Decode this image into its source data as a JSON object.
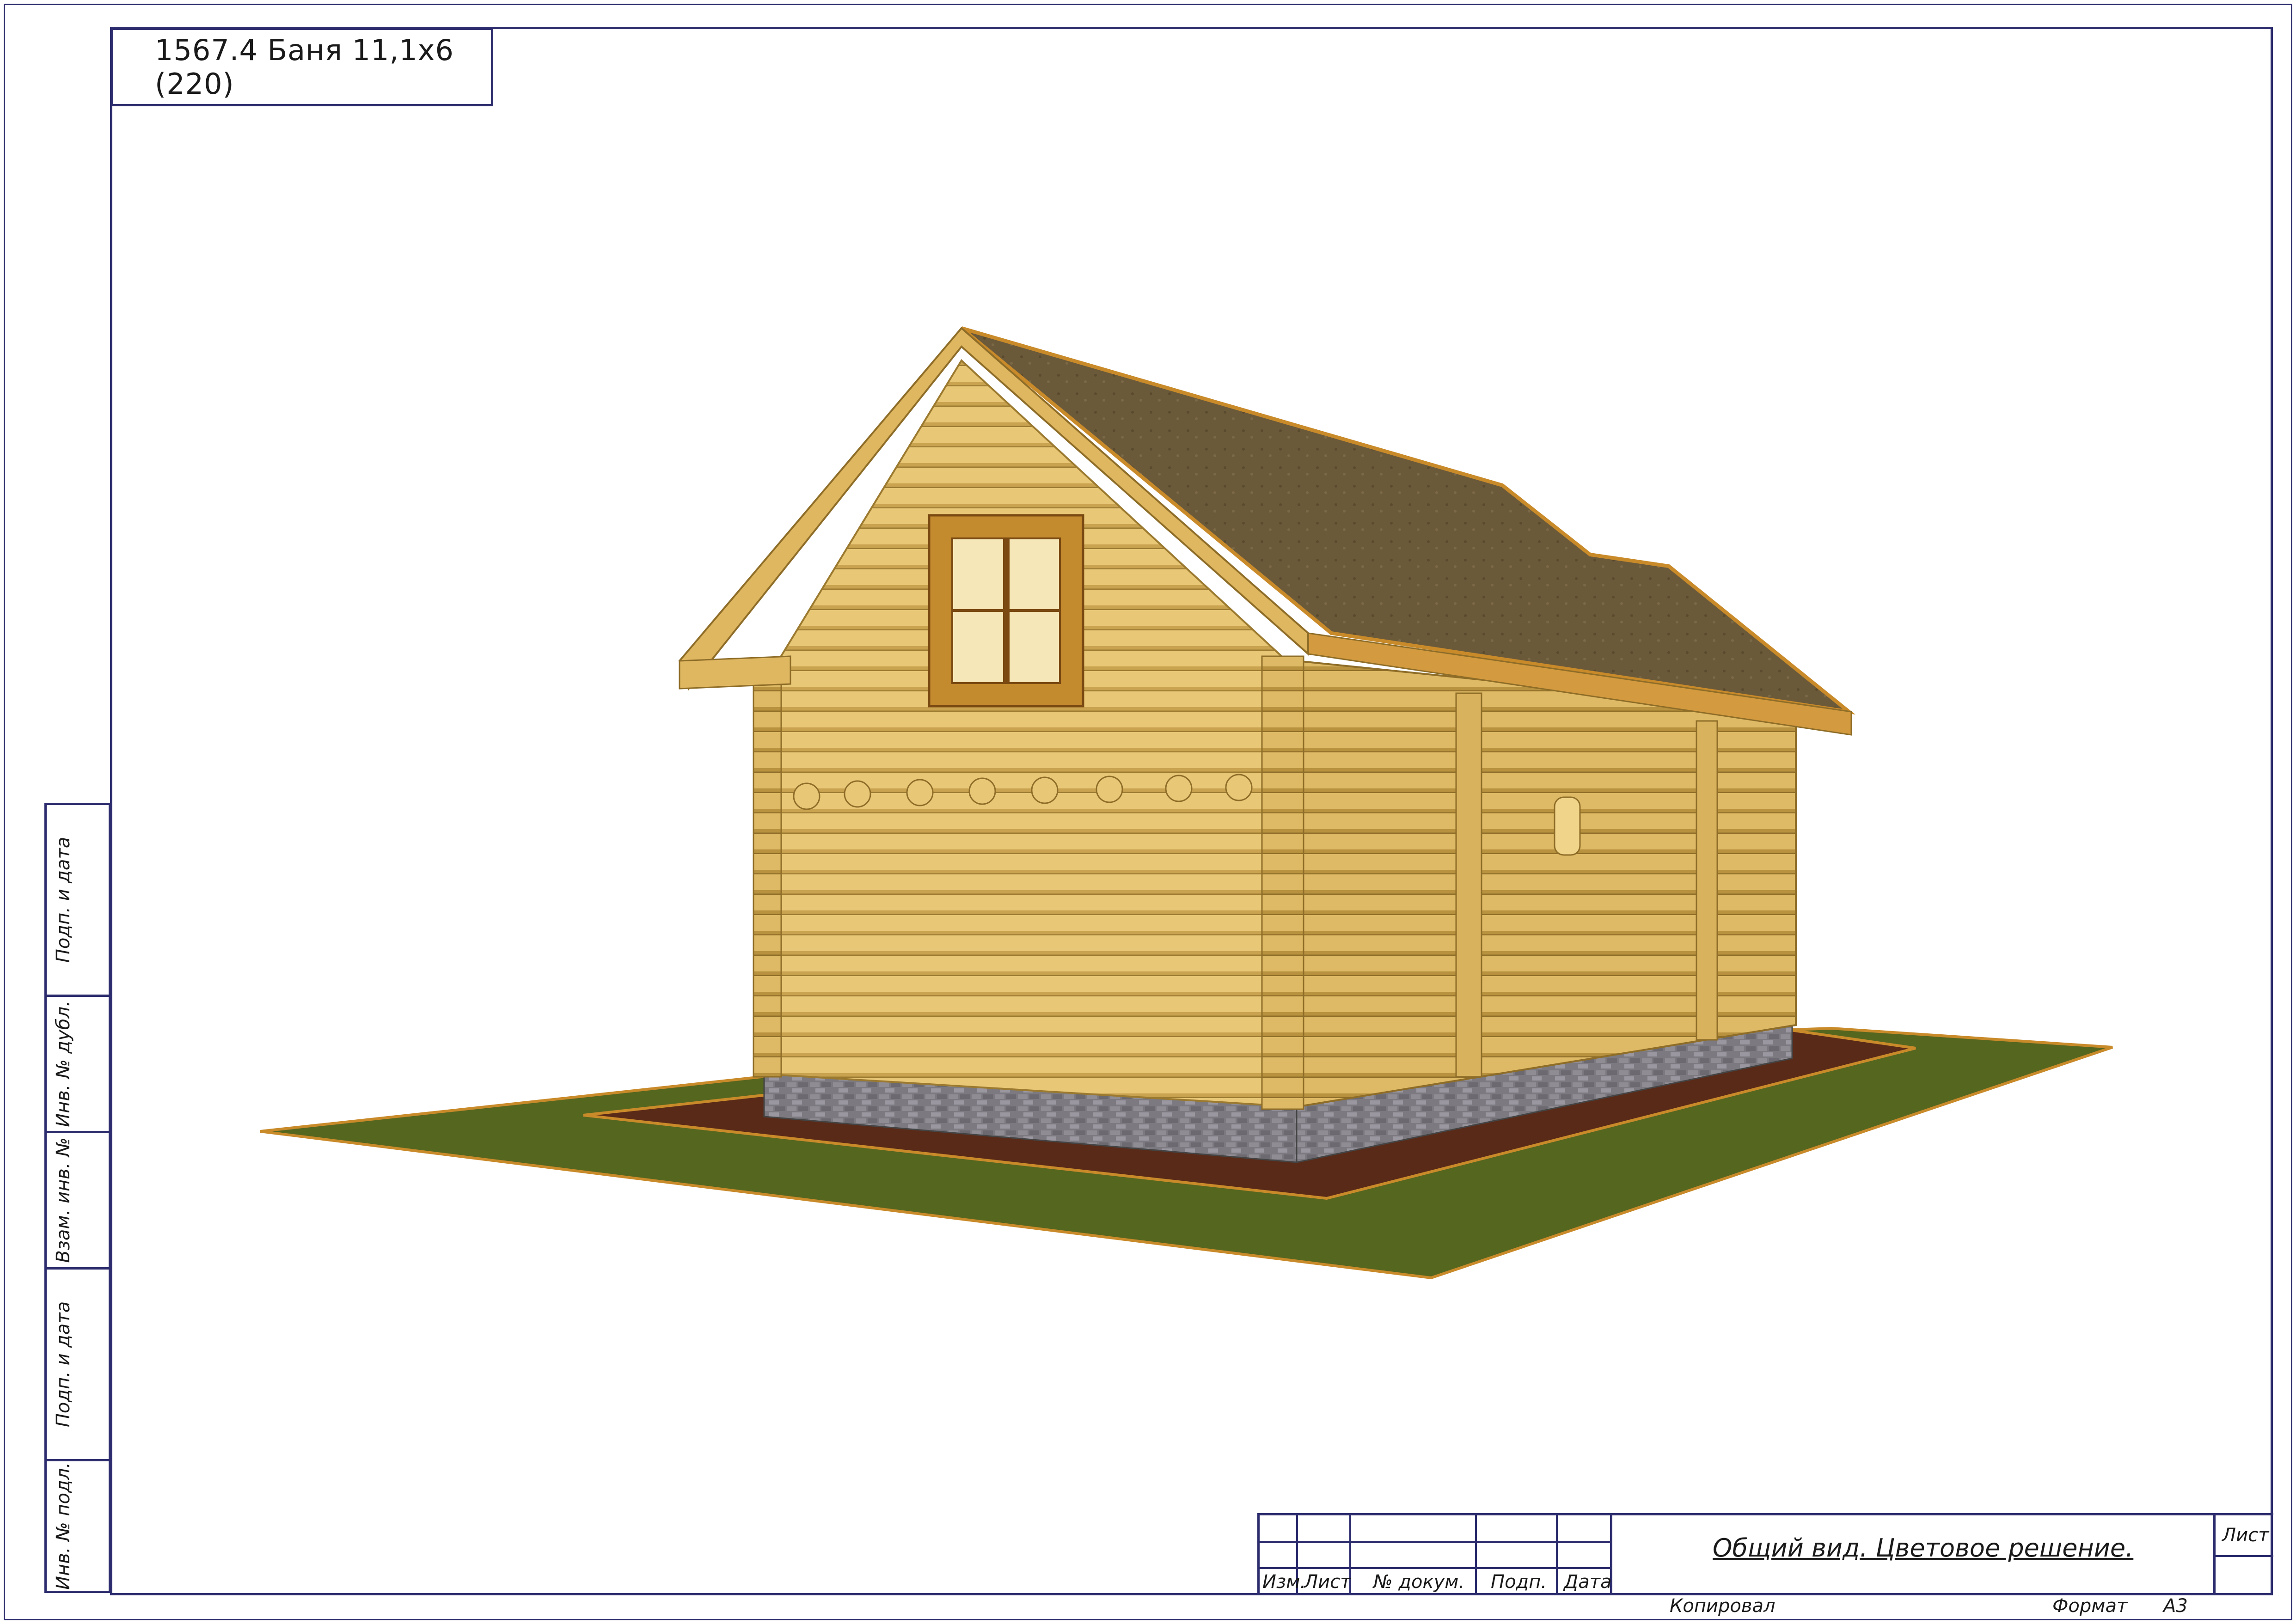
{
  "sheet": {
    "project_title": "1567.4 Баня 11,1х6 (220)",
    "sheet_title": "Общий вид. Цветовое решение.",
    "side_labels": [
      "Подп. и дата",
      "Инв. № дубл.",
      "Взам. инв. №",
      "Подп. и дата",
      "Инв. № подл."
    ],
    "stamp_headers": [
      "Изм.",
      "Лист",
      "№ докум.",
      "Подп.",
      "Дата"
    ],
    "sheet_label": "Лист",
    "copied_label": "Копировал",
    "format_label": "Формат",
    "format_value": "А3"
  },
  "colors": {
    "frame": "#2c2c6e",
    "log_wall": "#e8c777",
    "log_shadow": "#b8923f",
    "roof": "#6b5a3a",
    "roof_edge": "#c98a2a",
    "grass": "#55661f",
    "soil": "#5a2a18",
    "plinth": "#7c7a80",
    "window_frame": "#b8761f"
  },
  "drawing": {
    "image_icon": "house-render"
  }
}
